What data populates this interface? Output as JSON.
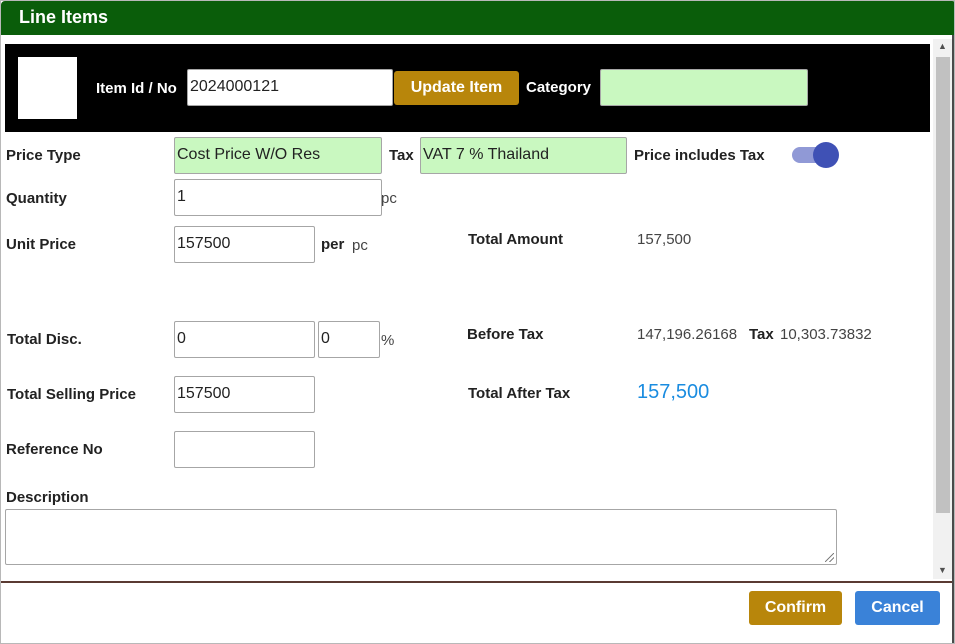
{
  "dialog": {
    "title": "Line Items"
  },
  "header": {
    "item_id_label": "Item Id / No",
    "item_id_value": "2024000121",
    "update_button": "Update Item",
    "category_label": "Category",
    "category_value": ""
  },
  "form": {
    "price_type_label": "Price Type",
    "price_type_value": "Cost Price W/O Res",
    "tax_label": "Tax",
    "tax_value": "VAT 7 % Thailand",
    "price_includes_tax_label": "Price includes Tax",
    "price_includes_tax_on": true,
    "quantity_label": "Quantity",
    "quantity_value": "1",
    "quantity_unit": "pc",
    "unit_price_label": "Unit Price",
    "unit_price_value": "157500",
    "per_label": "per",
    "unit_price_unit": "pc",
    "total_disc_label": "Total Disc.",
    "total_disc_amount": "0",
    "total_disc_percent": "0",
    "percent_symbol": "%",
    "total_selling_price_label": "Total Selling Price",
    "total_selling_price_value": "157500",
    "reference_no_label": "Reference No",
    "reference_no_value": "",
    "description_label": "Description",
    "description_value": ""
  },
  "summary": {
    "total_amount_label": "Total Amount",
    "total_amount_value": "157,500",
    "before_tax_label": "Before Tax",
    "before_tax_value": "147,196.26168",
    "tax_label": "Tax",
    "tax_value": "10,303.73832",
    "total_after_tax_label": "Total After Tax",
    "total_after_tax_value": "157,500",
    "total_after_tax_color": "#1a8ce0"
  },
  "footer": {
    "confirm_button": "Confirm",
    "cancel_button": "Cancel"
  },
  "scrollbar": {
    "up_icon": "triangle-up-icon",
    "down_icon": "triangle-down-icon"
  },
  "colors": {
    "title_bar": "#0a5d0a",
    "green_field": "#c9f8c0",
    "gold_button": "#b8860b",
    "blue_button": "#3a82d8",
    "toggle": "#3f51b5"
  }
}
